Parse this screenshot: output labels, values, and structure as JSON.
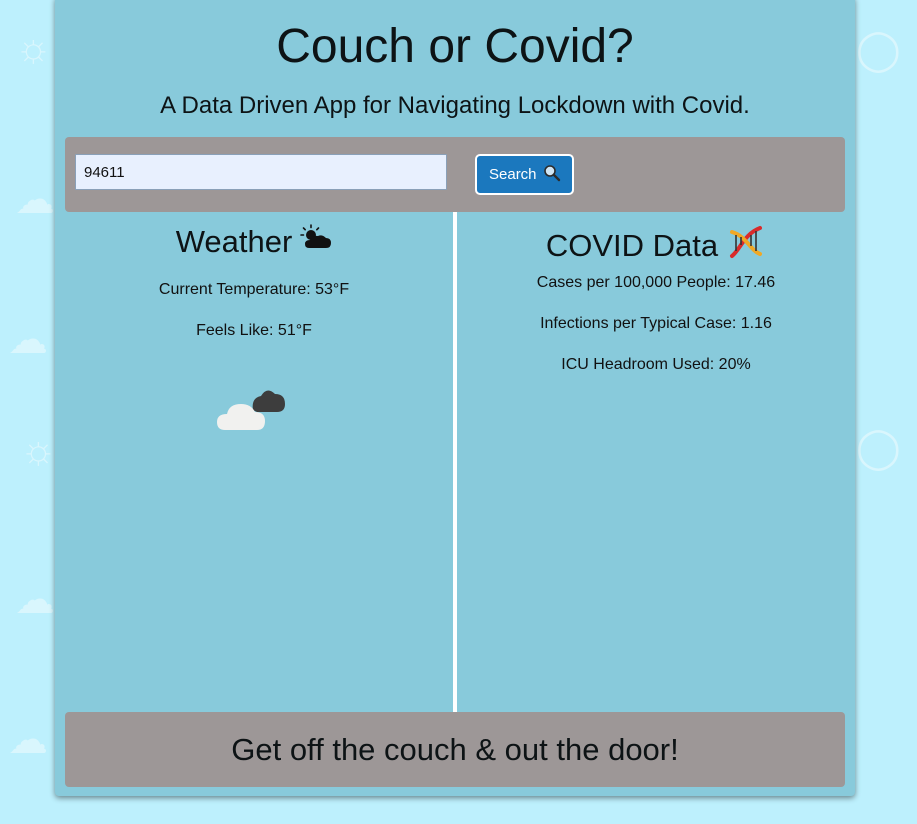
{
  "header": {
    "title": "Couch or Covid?",
    "subtitle": "A Data Driven App for Navigating Lockdown with Covid."
  },
  "search": {
    "value": "94611",
    "button_label": "Search",
    "button_icon": "magnifier-icon"
  },
  "weather": {
    "title": "Weather",
    "title_icon": "sun-behind-cloud-icon",
    "current_temperature": "Current Temperature: 53°F",
    "feels_like": "Feels Like: 51°F",
    "condition_icon": "cloudy-icon"
  },
  "covid": {
    "title": "COVID Data",
    "title_icon": "dna-icon",
    "cases": "Cases per 100,000 People: 17.46",
    "infections": "Infections per Typical Case: 1.16",
    "icu": "ICU Headroom Used: 20%"
  },
  "footer": {
    "message": "Get off the couch & out the door!"
  },
  "colors": {
    "page_background": "#bdf0fd",
    "panel_background": "#88cadb",
    "bar_background": "#9d9797",
    "button_background": "#1b78be"
  }
}
